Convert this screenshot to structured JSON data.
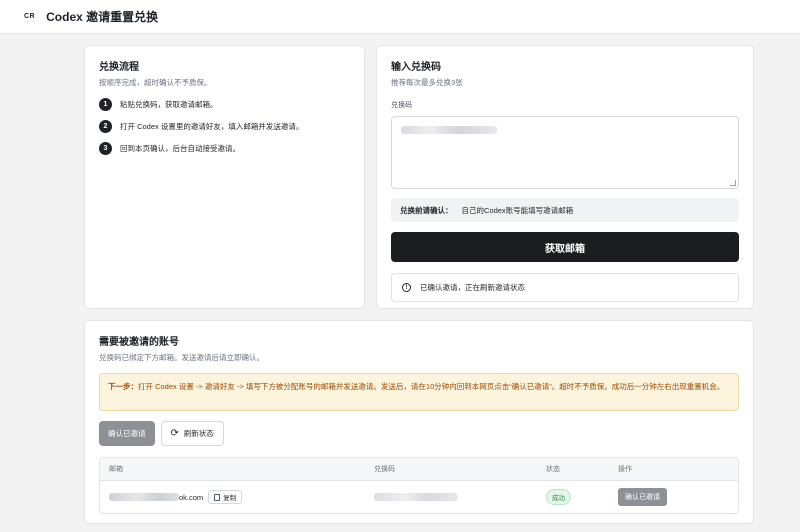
{
  "header": {
    "logo": "CR",
    "title": "Codex 邀请重置兑换"
  },
  "flow": {
    "title": "兑换流程",
    "subtitle": "按顺序完成，超时确认不予质保。",
    "steps": [
      {
        "num": "1",
        "text": "粘贴兑换码，获取邀请邮箱。"
      },
      {
        "num": "2",
        "text": "打开 Codex 设置里的邀请好友，填入邮箱并发送邀请。"
      },
      {
        "num": "3",
        "text": "回到本页确认，后台自动接受邀请。"
      }
    ]
  },
  "redeem": {
    "title": "输入兑换码",
    "subtitle": "推荐每次最多兑换3张",
    "field_label": "兑换码",
    "confirm_label": "兑换前请确认：",
    "confirm_text": "自己的Codex账号能填写邀请邮箱",
    "submit_label": "获取邮箱",
    "status_icon": "info-icon",
    "status_text": "已确认邀请，正在刷新邀请状态"
  },
  "accounts": {
    "title": "需要被邀请的账号",
    "subtitle": "兑换码已绑定下方邮箱。发送邀请后请立即确认。",
    "notice_label": "下一步：",
    "notice_text": "打开 Codex 设置 -> 邀请好友 -> 填写下方被分配账号的邮箱并发送邀请。发送后，请在10分钟内回到本网页点击“确认已邀请”。超时不予质保。成功后一分钟左右出现重置机会。",
    "confirm_button": "确认已邀请",
    "refresh_button": "刷新状态",
    "refresh_icon": "refresh-icon",
    "columns": [
      "邮箱",
      "兑换码",
      "状态",
      "操作"
    ],
    "rows": [
      {
        "email_suffix": "ok.com",
        "copy_label": "复制",
        "status": "成功",
        "action": "确认已邀请"
      }
    ]
  },
  "colors": {
    "primary": "#1c1d20",
    "notice_bg": "#fdf4dd",
    "notice_text": "#9a4a06",
    "success": "#2f8a45",
    "gray_button": "#8d9095"
  }
}
